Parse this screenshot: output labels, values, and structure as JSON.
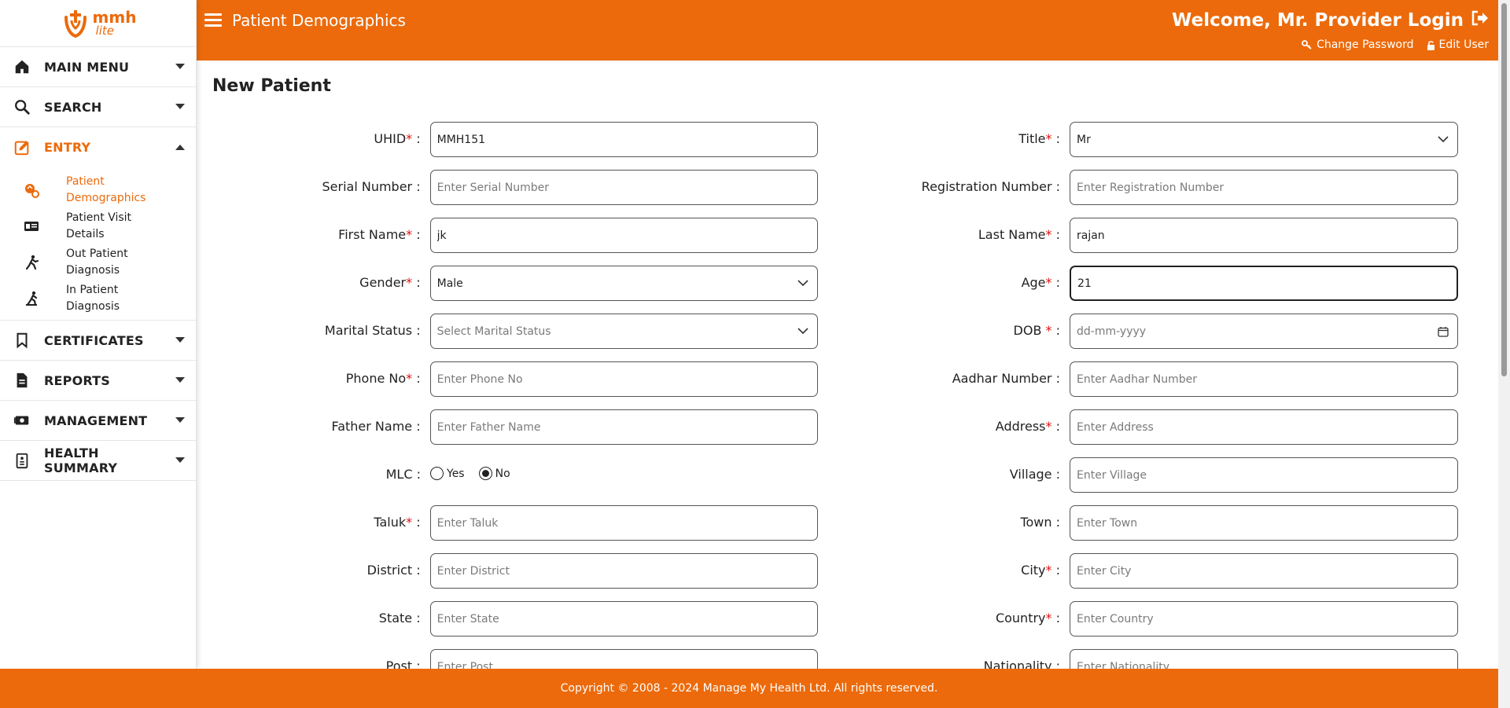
{
  "brand": {
    "main": "mmh",
    "sub": "lite",
    "color": "#EC6A0B"
  },
  "sidebar": {
    "items": [
      {
        "label": "MAIN MENU",
        "icon": "home-icon"
      },
      {
        "label": "SEARCH",
        "icon": "search-icon"
      },
      {
        "label": "ENTRY",
        "icon": "edit-icon",
        "expanded": true,
        "children": [
          {
            "label": "Patient Demographics",
            "icon": "patient-demographics-icon",
            "active": true
          },
          {
            "label": "Patient Visit Details",
            "icon": "id-card-icon"
          },
          {
            "label": "Out Patient Diagnosis",
            "icon": "walking-person-icon"
          },
          {
            "label": "In Patient Diagnosis",
            "icon": "bed-person-icon"
          }
        ]
      },
      {
        "label": "CERTIFICATES",
        "icon": "bookmark-icon"
      },
      {
        "label": "REPORTS",
        "icon": "document-icon"
      },
      {
        "label": "MANAGEMENT",
        "icon": "money-icon"
      },
      {
        "label": "HEALTH SUMMARY",
        "icon": "clipboard-icon"
      }
    ]
  },
  "header": {
    "title": "Patient Demographics",
    "welcome": "Welcome, Mr. Provider Login",
    "change_password": "Change Password",
    "edit_user": "Edit User"
  },
  "main": {
    "page_title": "New Patient",
    "left_fields": [
      {
        "label": "UHID",
        "required": true,
        "type": "text",
        "value": "MMH151",
        "placeholder": ""
      },
      {
        "label": "Serial Number",
        "required": false,
        "type": "text",
        "value": "",
        "placeholder": "Enter Serial Number"
      },
      {
        "label": "First Name",
        "required": true,
        "type": "text",
        "value": "jk",
        "placeholder": ""
      },
      {
        "label": "Gender",
        "required": true,
        "type": "select",
        "value": "Male",
        "placeholder": ""
      },
      {
        "label": "Marital Status",
        "required": false,
        "type": "select",
        "value": "",
        "placeholder": "Select Marital Status"
      },
      {
        "label": "Phone No",
        "required": true,
        "type": "text",
        "value": "",
        "placeholder": "Enter Phone No"
      },
      {
        "label": "Father Name",
        "required": false,
        "type": "text",
        "value": "",
        "placeholder": "Enter Father Name"
      },
      {
        "label": "MLC",
        "required": false,
        "type": "radio",
        "options": [
          "Yes",
          "No"
        ],
        "selected": "No"
      },
      {
        "label": "Taluk",
        "required": true,
        "type": "text",
        "value": "",
        "placeholder": "Enter Taluk"
      },
      {
        "label": "District",
        "required": false,
        "type": "text",
        "value": "",
        "placeholder": "Enter District"
      },
      {
        "label": "State",
        "required": false,
        "type": "text",
        "value": "",
        "placeholder": "Enter State"
      },
      {
        "label": "Post",
        "required": false,
        "type": "text",
        "value": "",
        "placeholder": "Enter Post"
      }
    ],
    "right_fields": [
      {
        "label": "Title",
        "required": true,
        "type": "select",
        "value": "Mr",
        "placeholder": ""
      },
      {
        "label": "Registration Number",
        "required": false,
        "type": "text",
        "value": "",
        "placeholder": "Enter Registration Number"
      },
      {
        "label": "Last Name",
        "required": true,
        "type": "text",
        "value": "rajan",
        "placeholder": ""
      },
      {
        "label": "Age",
        "required": true,
        "type": "text",
        "value": "21",
        "placeholder": "",
        "focused": true
      },
      {
        "label": "DOB ",
        "required": true,
        "type": "date",
        "value": "",
        "placeholder": "dd-mm-yyyy"
      },
      {
        "label": "Aadhar Number",
        "required": false,
        "type": "text",
        "value": "",
        "placeholder": "Enter Aadhar Number"
      },
      {
        "label": "Address",
        "required": true,
        "type": "text",
        "value": "",
        "placeholder": "Enter Address"
      },
      {
        "label": "Village",
        "required": false,
        "type": "text",
        "value": "",
        "placeholder": "Enter Village"
      },
      {
        "label": "Town",
        "required": false,
        "type": "text",
        "value": "",
        "placeholder": "Enter Town"
      },
      {
        "label": "City",
        "required": true,
        "type": "text",
        "value": "",
        "placeholder": "Enter City"
      },
      {
        "label": "Country",
        "required": true,
        "type": "text",
        "value": "",
        "placeholder": "Enter Country"
      },
      {
        "label": "Nationality",
        "required": false,
        "type": "text",
        "value": "",
        "placeholder": "Enter Nationality"
      }
    ]
  },
  "footer": {
    "text": "Copyright © 2008 - 2024 Manage My Health Ltd. All rights reserved."
  }
}
